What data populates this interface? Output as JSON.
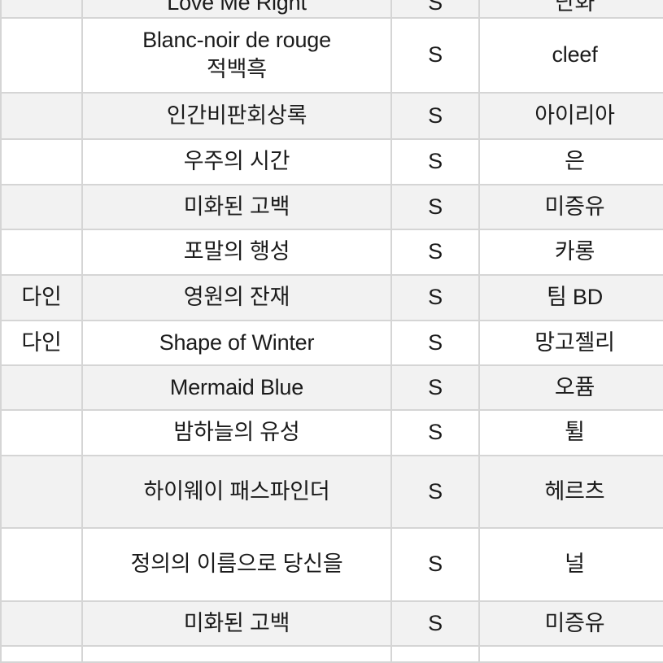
{
  "document": {
    "kind": "spreadsheet-table",
    "visible_region_note": "table scrolled; first and last rows clipped",
    "colors": {
      "page_background": "#ffffff",
      "row_shaded": "#f2f2f2",
      "row_plain": "#ffffff",
      "gridline": "#d5d5d5",
      "text": "#1b1b1b"
    }
  },
  "table": {
    "columns": [
      {
        "key": "artist",
        "name": "artist-column"
      },
      {
        "key": "title",
        "name": "title-column"
      },
      {
        "key": "grade",
        "name": "grade-column"
      },
      {
        "key": "extra",
        "name": "extra-column"
      }
    ],
    "rows": [
      {
        "artist": "",
        "title": "Love Me Right",
        "grade": "S",
        "extra": "단화",
        "height": 28,
        "shaded": true,
        "clipped_top": true
      },
      {
        "artist": "",
        "title": "Blanc-noir de rouge\n적백흑",
        "title_line1": "Blanc-noir de rouge",
        "title_line2": "적백흑",
        "grade": "S",
        "extra": "cleef",
        "height": 92,
        "shaded": false
      },
      {
        "artist": "",
        "title": "인간비판회상록",
        "grade": "S",
        "extra": "아이리아",
        "height": 57,
        "shaded": true
      },
      {
        "artist": "",
        "title": "우주의 시간",
        "grade": "S",
        "extra": "은",
        "height": 56,
        "shaded": false
      },
      {
        "artist": "",
        "title": "미화된 고백",
        "grade": "S",
        "extra": "미증유",
        "height": 55,
        "shaded": true
      },
      {
        "artist": "",
        "title": "포말의 행성",
        "grade": "S",
        "extra": "카롱",
        "height": 56,
        "shaded": false
      },
      {
        "artist": "다인",
        "title": "영원의 잔재",
        "grade": "S",
        "extra": "팀 BD",
        "height": 56,
        "shaded": true
      },
      {
        "artist": "다인",
        "title": "Shape of Winter",
        "grade": "S",
        "extra": "망고젤리",
        "height": 55,
        "shaded": false
      },
      {
        "artist": "",
        "title": "Mermaid Blue",
        "grade": "S",
        "extra": "오퓸",
        "height": 55,
        "shaded": true
      },
      {
        "artist": "",
        "title": "밤하늘의 유성",
        "grade": "S",
        "extra": "튈",
        "height": 56,
        "shaded": false
      },
      {
        "artist": "",
        "title": "하이웨이 패스파인더",
        "grade": "S",
        "extra": "헤르츠",
        "height": 89,
        "shaded": true
      },
      {
        "artist": "",
        "title": "정의의 이름으로 당신을",
        "grade": "S",
        "extra": "널",
        "height": 90,
        "shaded": false
      },
      {
        "artist": "",
        "title": "미화된 고백",
        "grade": "S",
        "extra": "미증유",
        "height": 55,
        "shaded": true
      },
      {
        "artist": "",
        "title": "",
        "grade": "",
        "extra": "",
        "height": 20,
        "shaded": false,
        "clipped_bottom": true
      }
    ]
  }
}
